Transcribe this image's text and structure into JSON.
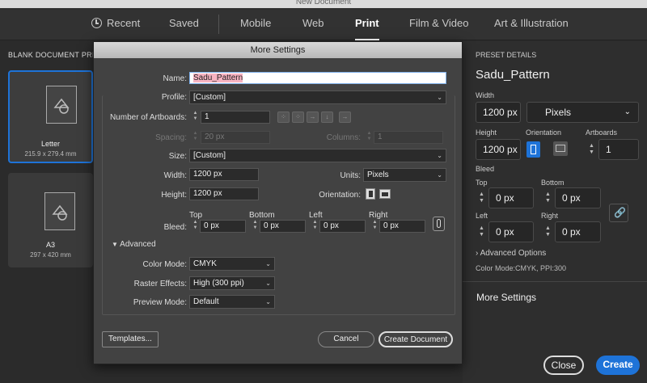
{
  "window": {
    "title": "New Document"
  },
  "nav": {
    "tabs": [
      "Recent",
      "Saved",
      "Mobile",
      "Web",
      "Print",
      "Film & Video",
      "Art & Illustration"
    ],
    "active": "Print"
  },
  "left": {
    "section_title": "BLANK DOCUMENT PRESETS",
    "presets": [
      {
        "name": "Letter",
        "size": "215.9 x 279.4 mm"
      },
      {
        "name": "A3",
        "size": "297 x 420 mm"
      }
    ]
  },
  "details": {
    "section_title": "PRESET DETAILS",
    "name": "Sadu_Pattern",
    "width_label": "Width",
    "width": "1200 px",
    "units": "Pixels",
    "height_label": "Height",
    "height": "1200 px",
    "orientation_label": "Orientation",
    "artboards_label": "Artboards",
    "artboards": "1",
    "bleed_label": "Bleed",
    "top_label": "Top",
    "bottom_label": "Bottom",
    "left_label": "Left",
    "right_label": "Right",
    "bleed_top": "0 px",
    "bleed_bottom": "0 px",
    "bleed_left": "0 px",
    "bleed_right": "0 px",
    "advanced_options": "Advanced Options",
    "color_info": "Color Mode:CMYK, PPI:300",
    "more_settings": "More Settings",
    "close": "Close",
    "create": "Create"
  },
  "dialog": {
    "title": "More Settings",
    "name_label": "Name:",
    "name": "Sadu_Pattern",
    "profile_label": "Profile:",
    "profile": "[Custom]",
    "artboards_label": "Number of Artboards:",
    "artboards": "1",
    "spacing_label": "Spacing:",
    "spacing": "20 px",
    "columns_label": "Columns:",
    "columns": "1",
    "size_label": "Size:",
    "size": "[Custom]",
    "width_label": "Width:",
    "width": "1200 px",
    "units_label": "Units:",
    "units": "Pixels",
    "height_label": "Height:",
    "height": "1200 px",
    "orientation_label": "Orientation:",
    "bleed_label": "Bleed:",
    "top_label": "Top",
    "bottom_label": "Bottom",
    "left_label": "Left",
    "right_label": "Right",
    "bleed_top": "0 px",
    "bleed_bottom": "0 px",
    "bleed_left": "0 px",
    "bleed_right": "0 px",
    "advanced_label": "Advanced",
    "color_mode_label": "Color Mode:",
    "color_mode": "CMYK",
    "raster_label": "Raster Effects:",
    "raster": "High (300 ppi)",
    "preview_label": "Preview Mode:",
    "preview": "Default",
    "templates": "Templates...",
    "cancel": "Cancel",
    "create": "Create Document"
  },
  "colors": {
    "accent": "#1e73d8",
    "highlight": "#f7b3c2"
  }
}
